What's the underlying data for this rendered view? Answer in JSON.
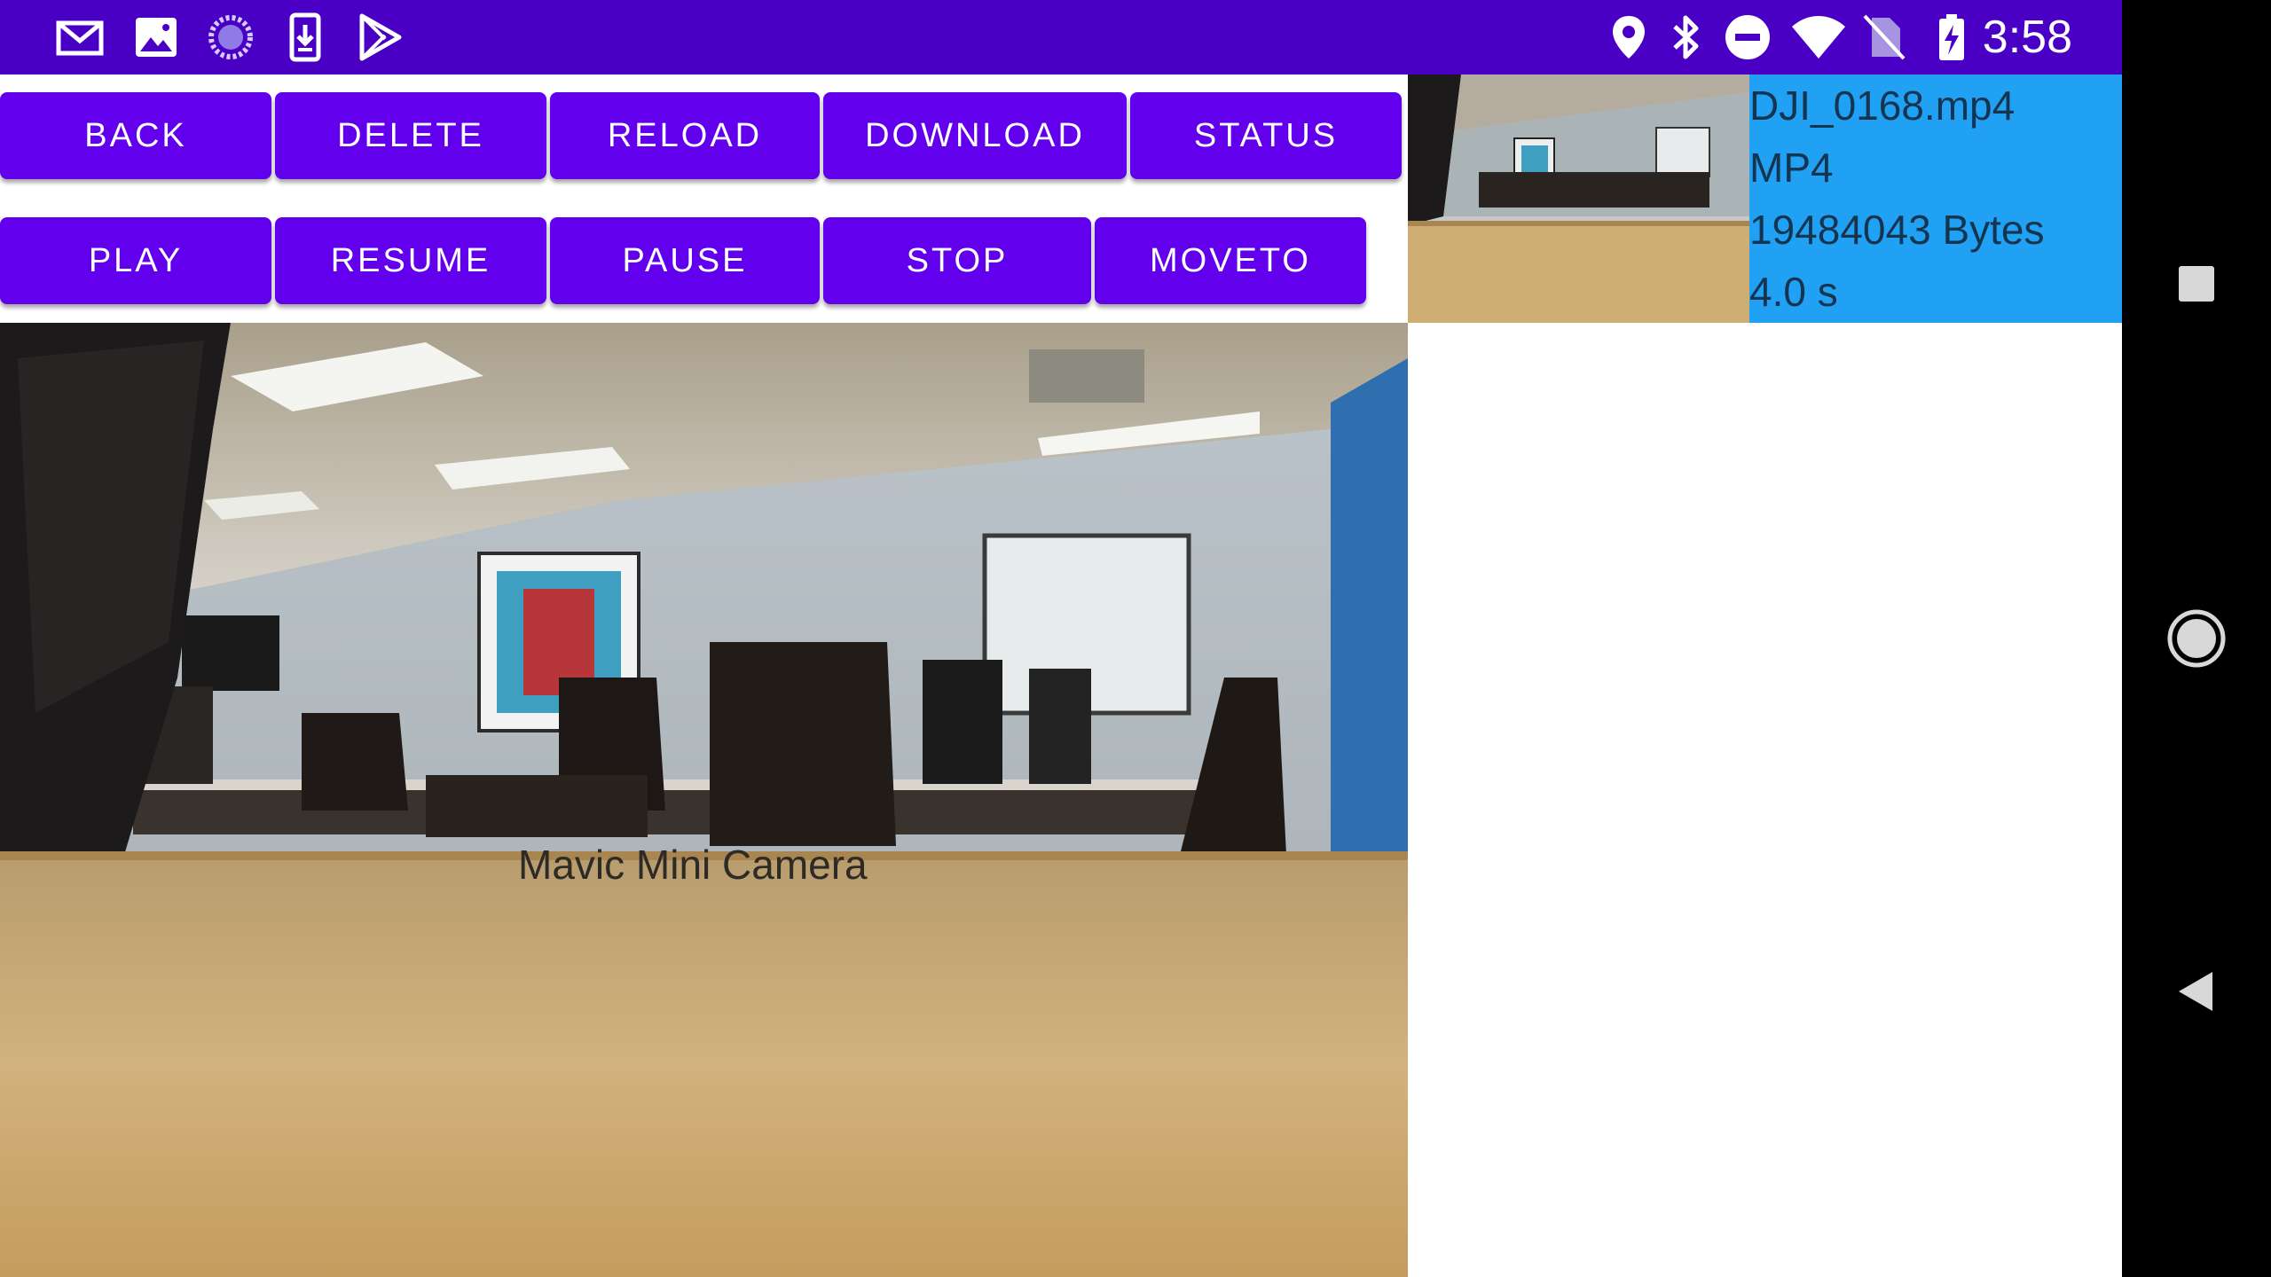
{
  "status_bar": {
    "time": "3:58",
    "left_icons": [
      "gmail-icon",
      "photos-icon",
      "sync-icon",
      "download-icon",
      "play-store-icon"
    ],
    "right_icons": [
      "location-icon",
      "bluetooth-icon",
      "do-not-disturb-icon",
      "wifi-icon",
      "no-sim-icon",
      "battery-charging-icon"
    ],
    "background": "#4a00c4"
  },
  "toolbar": {
    "row1": [
      "BACK",
      "DELETE",
      "RELOAD",
      "DOWNLOAD",
      "STATUS"
    ],
    "row2": [
      "PLAY",
      "RESUME",
      "PAUSE",
      "STOP",
      "MOVETO"
    ],
    "button_color": "#6200ee"
  },
  "preview": {
    "label": "Mavic Mini Camera"
  },
  "media_list": [
    {
      "name": "DJI_0168.mp4",
      "type": "MP4",
      "size": "19484043 Bytes",
      "duration": "4.0 s"
    }
  ],
  "nav_bar": {
    "buttons": [
      "recents-icon",
      "home-icon",
      "back-icon"
    ]
  },
  "colors": {
    "selected_item": "#21a1f3",
    "status_bar": "#4a00c4",
    "primary": "#6200ee"
  }
}
